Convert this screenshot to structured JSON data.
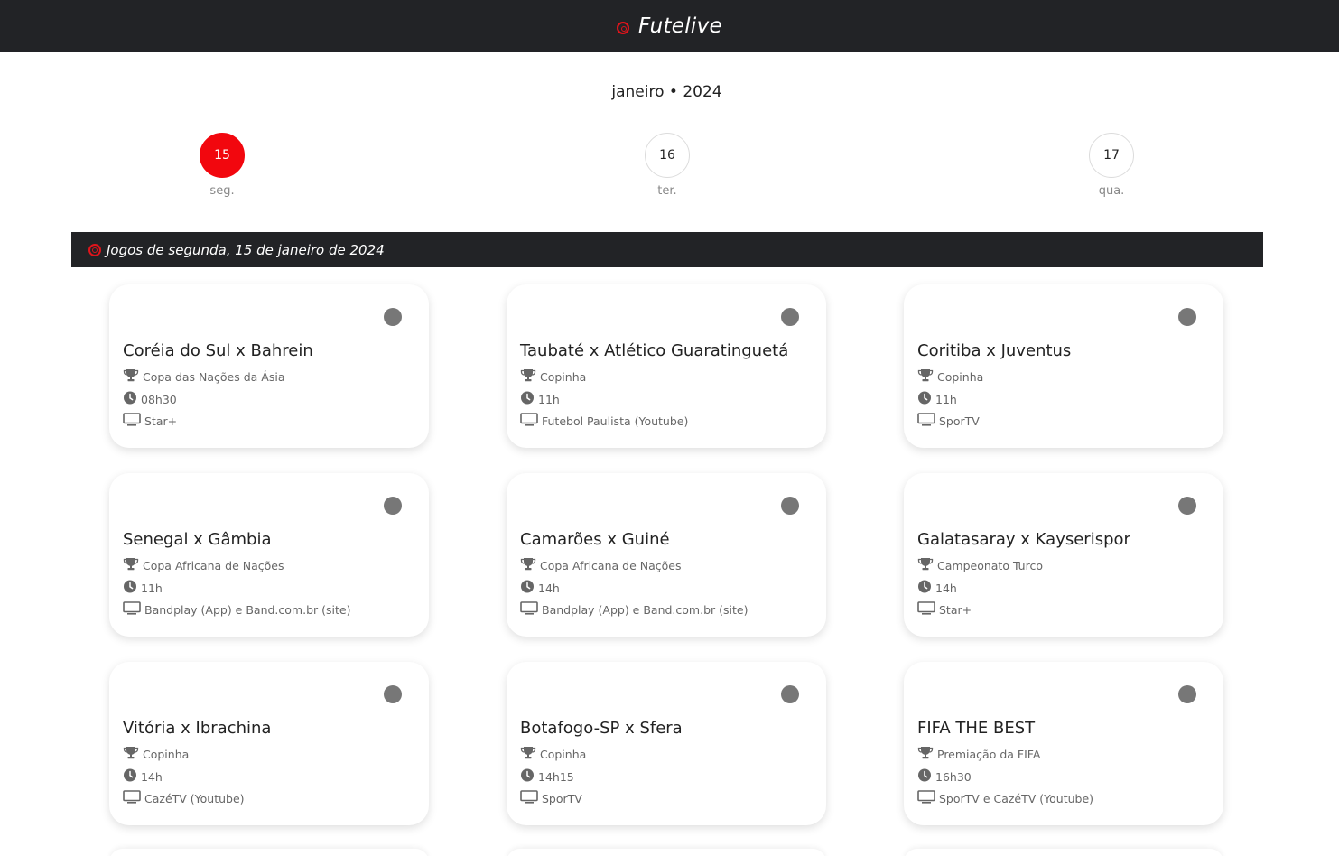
{
  "header": {
    "brand": "Futelive"
  },
  "calendar": {
    "month_label": "janeiro • 2024",
    "days": [
      {
        "number": "15",
        "weekday": "seg."
      },
      {
        "number": "16",
        "weekday": "ter."
      },
      {
        "number": "17",
        "weekday": "qua."
      }
    ]
  },
  "section": {
    "title": "Jogos de segunda, 15 de janeiro de 2024"
  },
  "games": [
    {
      "match": "Coréia do Sul x Bahrein",
      "competition": "Copa das Nações da Ásia",
      "time": "08h30",
      "broadcast": "Star+"
    },
    {
      "match": "Taubaté x Atlético Guaratinguetá",
      "competition": "Copinha",
      "time": "11h",
      "broadcast": "Futebol Paulista (Youtube)"
    },
    {
      "match": "Coritiba x Juventus",
      "competition": "Copinha",
      "time": "11h",
      "broadcast": "SporTV"
    },
    {
      "match": "Senegal x Gâmbia",
      "competition": "Copa Africana de Nações",
      "time": "11h",
      "broadcast": "Bandplay (App) e Band.com.br (site)"
    },
    {
      "match": "Camarões x Guiné",
      "competition": "Copa Africana de Nações",
      "time": "14h",
      "broadcast": "Bandplay (App) e Band.com.br (site)"
    },
    {
      "match": "Galatasaray x Kayserispor",
      "competition": "Campeonato Turco",
      "time": "14h",
      "broadcast": "Star+"
    },
    {
      "match": "Vitória x Ibrachina",
      "competition": "Copinha",
      "time": "14h",
      "broadcast": "CazéTV (Youtube)"
    },
    {
      "match": "Botafogo-SP x Sfera",
      "competition": "Copinha",
      "time": "14h15",
      "broadcast": "SporTV"
    },
    {
      "match": "FIFA THE BEST",
      "competition": "Premiação da FIFA",
      "time": "16h30",
      "broadcast": "SporTV e CazéTV (Youtube)"
    }
  ],
  "icons": {
    "competition": "trophy-icon",
    "time": "clock-icon",
    "broadcast": "tv-icon",
    "status": "status-dot-icon"
  },
  "colors": {
    "accent": "#f2070e",
    "bar": "#222326",
    "status": "#777777"
  }
}
